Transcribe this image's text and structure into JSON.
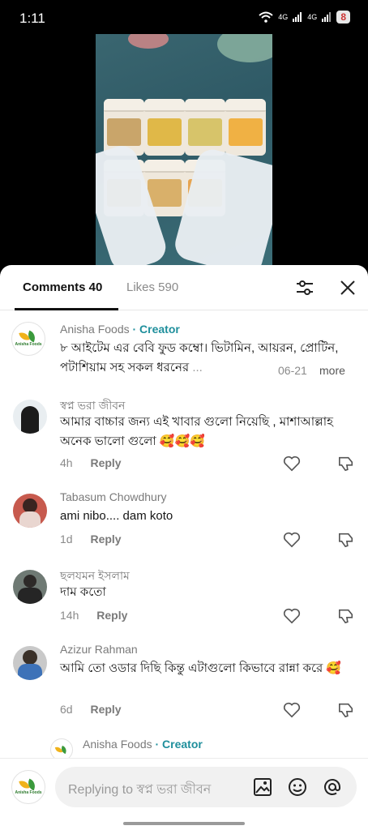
{
  "status": {
    "time": "1:11",
    "net1": "4G",
    "net2": "4G",
    "battery": "8"
  },
  "tabs": {
    "comments": "Comments 40",
    "likes": "Likes 590"
  },
  "comments": [
    {
      "user": "Anisha Foods",
      "creator": "· Creator",
      "text": "৮ আইটেম এর বেবি ফুড কম্বো। ভিটামিন, আয়রন, প্রোটিন, পটাশিয়াম সহ সকল ধরনের ",
      "ellipsis": "... ",
      "date": "06-21",
      "more": "more",
      "logo_text": "Anisha Foods"
    },
    {
      "user": "স্বপ্ন ভরা জীবন",
      "text": "আমার বাচ্চার জন্য এই খাবার গুলো নিয়েছি , মাশাআল্লাহ অনেক ভালো গুলো 🥰🥰🥰",
      "age": "4h",
      "reply": "Reply"
    },
    {
      "user": "Tabasum Chowdhury",
      "text": "ami nibo.... dam koto",
      "age": "1d",
      "reply": "Reply"
    },
    {
      "user": "ছলযমন ইসলাম",
      "text": "দাম কতো",
      "age": "14h",
      "reply": "Reply"
    },
    {
      "user": "Azizur Rahman",
      "text": "আমি তো ওডার দিছি কিন্তু এটাগুলো কিভাবে রান্না করে 🥰",
      "age": "6d",
      "reply": "Reply"
    },
    {
      "user": "Anisha Foods",
      "creator": "· Creator"
    }
  ],
  "input": {
    "placeholder": "Replying to স্বপ্ন ভরা জীবন"
  },
  "icons": [
    "filter-icon",
    "close-icon",
    "heart-icon",
    "dislike-icon",
    "image-icon",
    "emoji-icon",
    "mention-icon"
  ]
}
